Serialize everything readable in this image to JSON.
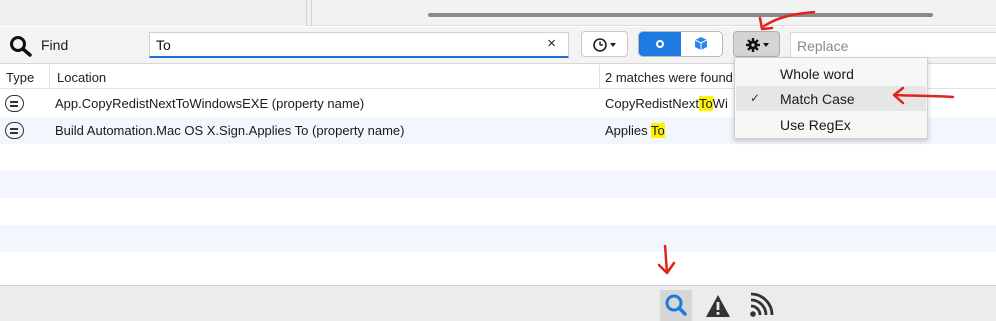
{
  "toolbar": {
    "find_label": "Find",
    "search_value": "To",
    "clear_glyph": "×",
    "history_icon": "clock-icon",
    "scope_left_icon": "solution-scope-icon",
    "scope_right_icon": "project-scope-icon",
    "options_icon": "gear-icon",
    "replace_placeholder": "Replace"
  },
  "table": {
    "headers": [
      "Type",
      "Location",
      "2 matches were found"
    ],
    "rows": [
      {
        "type_icon": "property-icon",
        "location": "App.CopyRedistNextToWindowsEXE (property name)",
        "match_before": "CopyRedistNext",
        "match_hit": "To",
        "match_after": "Wi"
      },
      {
        "type_icon": "property-icon",
        "location": "Build Automation.Mac OS X.Sign.Applies To (property name)",
        "match_before": "Applies ",
        "match_hit": "To",
        "match_after": ""
      }
    ]
  },
  "options_menu": {
    "items": [
      {
        "label": "Whole word",
        "checked": false
      },
      {
        "label": "Match Case",
        "checked": true
      },
      {
        "label": "Use RegEx",
        "checked": false
      }
    ],
    "check_glyph": "✓"
  },
  "bottom_tabs": [
    {
      "icon": "search-icon",
      "active": true
    },
    {
      "icon": "warning-icon",
      "active": false
    },
    {
      "icon": "feed-icon",
      "active": false
    }
  ],
  "colors": {
    "accent": "#1e7ae0",
    "highlight": "#fff200",
    "annotation": "#e0241b"
  }
}
